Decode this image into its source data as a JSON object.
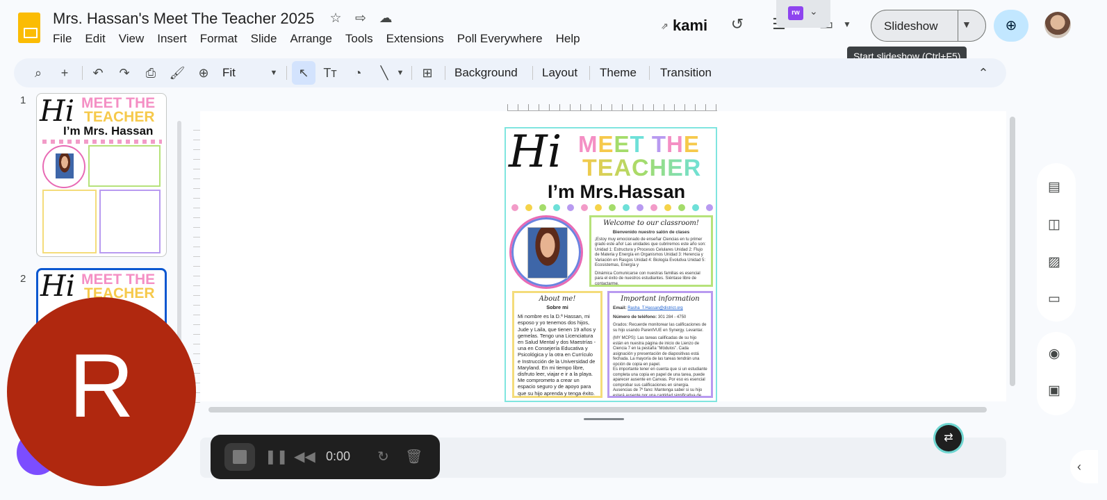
{
  "app": {
    "title": "Mrs. Hassan's Meet The Teacher 2025",
    "menu": [
      "File",
      "Edit",
      "View",
      "Insert",
      "Format",
      "Slide",
      "Arrange",
      "Tools",
      "Extensions",
      "Poll Everywhere",
      "Help"
    ],
    "kami_label": "kami",
    "slideshow_label": "Slideshow",
    "tooltip": "Start slideshow (Ctrl+F5)",
    "extension_badge": "rw"
  },
  "toolbar": {
    "zoom_label": "Fit",
    "background_label": "Background",
    "layout_label": "Layout",
    "theme_label": "Theme",
    "transition_label": "Transition"
  },
  "filmstrip": {
    "slides": [
      {
        "number": "1"
      },
      {
        "number": "2"
      }
    ]
  },
  "slide": {
    "hi": "Hi",
    "meet": "MEET THE",
    "teacher": "TEACHER",
    "im": "I’m Mrs.Hassan",
    "dot_colors": [
      "#f29bc8",
      "#f5d34a",
      "#a4dc6a",
      "#6ee0d8",
      "#b89af0",
      "#f29bc8",
      "#f5d34a",
      "#a4dc6a",
      "#6ee0d8",
      "#b89af0",
      "#f29bc8",
      "#f5d34a",
      "#a4dc6a",
      "#6ee0d8",
      "#b89af0"
    ],
    "welcome": {
      "title": "Welcome to our classroom!",
      "subtitle": "Bienvenido nuestro salón de clases",
      "body": "¡Estoy muy emocionado de enseñar Ciencias en tu primer grado este año! Las unidades que cubriremos este año son: Unidad 1: Estructura y Procesos Celulares Unidad 2: Flujo de Materia y Energía en Organismos Unidad 3: Herencia y Variación en Rasgos Unidad 4: Biología Evolutiva Unidad 5: Ecosistemas, Energía y",
      "footer": "Dinámica Comunicarse con nuestras familias es esencial para el éxito de nuestros estudiantes. Siéntase libre de contactarme."
    },
    "about": {
      "title": "About me!",
      "subtitle": "Sobre mi",
      "body": "Mi nombre es la D.ª Hassan, mi esposo y yo tenemos dos hijos, Jude y Laila, que tienen 19 años y gemelas. Tengo una Licenciatura en Salud Mental y dos Maestrías - una en Consejería Educativa y Psicológica y la otra en Currículo e Instrucción de la Universidad de Maryland. En mi tiempo libre, disfruto leer, viajar e ir a la playa. Me comprometo a crear un espacio seguro y de apoyo para que su hijo aprenda y tenga éxito."
    },
    "info": {
      "title": "Important information",
      "email_label": "Email:",
      "email_value": "Rasha_T.Hassan@district.org",
      "phone_label": "Número de teléfono:",
      "phone_value": "301 284 - 4750",
      "grades": "Grados: Recuerde monitorear las calificaciones de su hijo usando ParentVUE en Synergy. Levantar.",
      "mymcps": "(MY MCPS): Las tareas calificadas de su hijo están en nuestra página de inicio de Lienzo de Ciencia 7 en la pestaña \"Módulos\". Cada asignación y presentación de diapositivas está fechada. La mayoría de las tareas tendrán una opción de copia en papel.",
      "important": "Es importante tener en cuenta que si un estudiante completa una copia en papel de una tarea, puede aparecer ausente en Canvas. Por eso es esencial comprobar sus calificaciones en sinergia. Ausencias de 7º fano: Mantenga saber si su hijo estará ausente por una cantidad significativa de tiempo. Si, mientras está fuera de la escuela, su hijo puede acceder a nuestra página de inicio en Canvas, por favor pídales que revisen nuestras diapositivas semanales y completen cualquier tarea en \"Módulos\"."
    }
  },
  "thumb": {
    "meet": "MEET THE",
    "teacher": "TEACHER",
    "im": "I’m Mrs. Hassan"
  },
  "recorder": {
    "time": "0:00"
  },
  "presenter": {
    "initial": "R",
    "color": "#b0280f"
  }
}
